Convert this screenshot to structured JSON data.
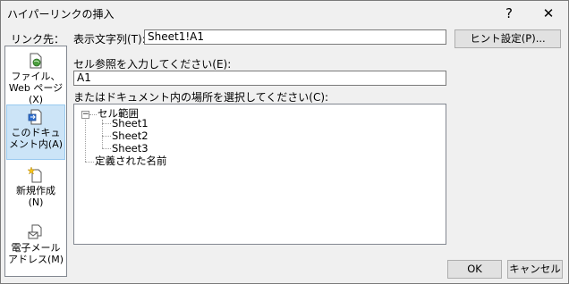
{
  "window": {
    "title": "ハイパーリンクの挿入",
    "help_glyph": "?",
    "close_glyph": "✕"
  },
  "sidebar": {
    "header": "リンク先：",
    "items": [
      {
        "label": "ファイル、\nWeb ページ\n(X)",
        "icon": "web-page-icon",
        "selected": false
      },
      {
        "label": "このドキュ\nメント内(A)",
        "icon": "document-place-icon",
        "selected": true
      },
      {
        "label": "新規作成\n(N)",
        "icon": "new-document-icon",
        "selected": false
      },
      {
        "label": "電子メール\nアドレス(M)",
        "icon": "email-address-icon",
        "selected": false
      }
    ]
  },
  "form": {
    "display_label": "表示文字列(T):",
    "display_value": "Sheet1!A1",
    "screentip_label": "ヒント設定(P)...",
    "cellref_label": "セル参照を入力してください(E):",
    "cellref_value": "A1",
    "place_label": "またはドキュメント内の場所を選択してください(C):"
  },
  "tree": {
    "root_expander": "−",
    "cell_range_label": "セル範囲",
    "sheets": [
      "Sheet1",
      "Sheet2",
      "Sheet3"
    ],
    "defined_names_label": "定義された名前"
  },
  "buttons": {
    "ok": "OK",
    "cancel": "キャンセル"
  },
  "colors": {
    "dialog_bg": "#f0f0f0",
    "selection_bg": "#cce4f7",
    "selection_border": "#99c9ef"
  }
}
